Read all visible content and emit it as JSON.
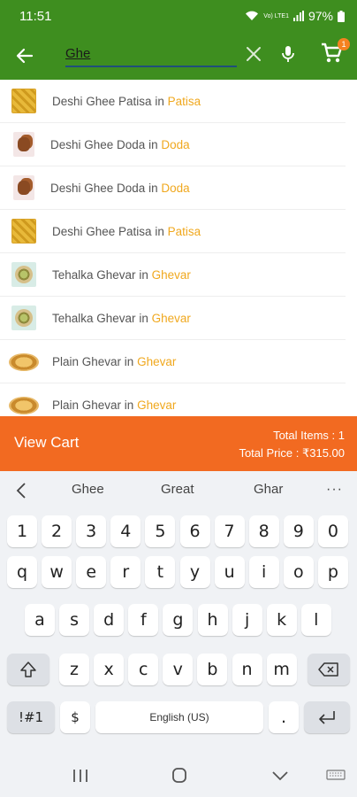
{
  "status": {
    "time": "11:51",
    "network": "Vo) LTE1",
    "battery": "97%"
  },
  "search": {
    "query": "Ghe"
  },
  "cart": {
    "badge_count": "1",
    "view_label": "View Cart",
    "total_items": "Total Items : 1",
    "total_price": "Total Price : ₹315.00"
  },
  "results": [
    {
      "thumb": "patisa",
      "name": "Deshi Ghee Patisa",
      "connector": " in ",
      "category": "Patisa"
    },
    {
      "thumb": "doda",
      "name": "Deshi Ghee Doda",
      "connector": " in ",
      "category": "Doda"
    },
    {
      "thumb": "doda",
      "name": "Deshi Ghee Doda",
      "connector": " in ",
      "category": "Doda"
    },
    {
      "thumb": "patisa",
      "name": "Deshi Ghee Patisa",
      "connector": " in ",
      "category": "Patisa"
    },
    {
      "thumb": "ghevar",
      "name": "Tehalka Ghevar",
      "connector": " in ",
      "category": "Ghevar"
    },
    {
      "thumb": "ghevar",
      "name": "Tehalka Ghevar",
      "connector": " in ",
      "category": "Ghevar"
    },
    {
      "thumb": "plain",
      "name": "Plain Ghevar",
      "connector": " in ",
      "category": "Ghevar"
    },
    {
      "thumb": "plain",
      "name": "Plain Ghevar",
      "connector": " in ",
      "category": "Ghevar"
    }
  ],
  "keyboard": {
    "suggestions": [
      "Ghee",
      "Great",
      "Ghar"
    ],
    "more": "···",
    "row1": [
      "1",
      "2",
      "3",
      "4",
      "5",
      "6",
      "7",
      "8",
      "9",
      "0"
    ],
    "row2": [
      "q",
      "w",
      "e",
      "r",
      "t",
      "y",
      "u",
      "i",
      "o",
      "p"
    ],
    "row3": [
      "a",
      "s",
      "d",
      "f",
      "g",
      "h",
      "j",
      "k",
      "l"
    ],
    "row4": [
      "z",
      "x",
      "c",
      "v",
      "b",
      "n",
      "m"
    ],
    "symbols_key": "!#1",
    "currency_key": "$",
    "space_label": "English (US)",
    "period_key": "."
  },
  "colors": {
    "primary_green": "#3e8e1f",
    "cart_orange": "#f26a21",
    "category_amber": "#f0a81e"
  },
  "icons": [
    "back-arrow-icon",
    "clear-icon",
    "mic-icon",
    "cart-icon",
    "shift-icon",
    "backspace-icon",
    "enter-icon",
    "recents-icon",
    "home-icon",
    "back-icon",
    "keyboard-icon"
  ]
}
